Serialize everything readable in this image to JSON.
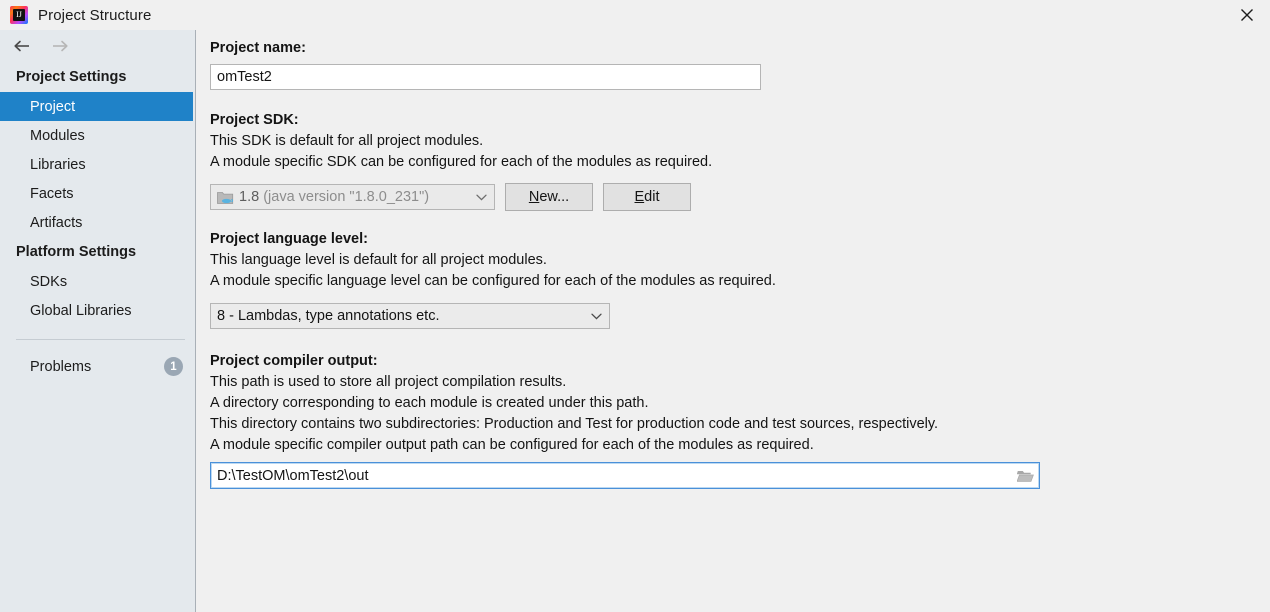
{
  "window": {
    "title": "Project Structure",
    "app_icon": "intellij-idea-logo",
    "close_icon": "close-icon"
  },
  "sidebar": {
    "nav": {
      "back_icon": "arrow-left-icon",
      "forward_icon": "arrow-right-icon"
    },
    "groups": [
      {
        "title": "Project Settings",
        "items": [
          {
            "label": "Project",
            "selected": true
          },
          {
            "label": "Modules",
            "selected": false
          },
          {
            "label": "Libraries",
            "selected": false
          },
          {
            "label": "Facets",
            "selected": false
          },
          {
            "label": "Artifacts",
            "selected": false
          }
        ]
      },
      {
        "title": "Platform Settings",
        "items": [
          {
            "label": "SDKs",
            "selected": false
          },
          {
            "label": "Global Libraries",
            "selected": false
          }
        ]
      }
    ],
    "problems": {
      "label": "Problems",
      "count": "1"
    }
  },
  "main": {
    "project_name": {
      "label": "Project name:",
      "value": "omTest2"
    },
    "project_sdk": {
      "label": "Project SDK:",
      "desc1": "This SDK is default for all project modules.",
      "desc2": "A module specific SDK can be configured for each of the modules as required.",
      "sdk_icon": "java-sdk-icon",
      "selected_version": "1.8",
      "selected_detail": "(java version \"1.8.0_231\")",
      "chevron_icon": "chevron-down-icon",
      "new_button": "New...",
      "new_button_mnemonic": "N",
      "new_button_rest": "ew...",
      "edit_button": "Edit",
      "edit_button_mnemonic": "E",
      "edit_button_rest": "dit"
    },
    "language_level": {
      "label": "Project language level:",
      "desc1": "This language level is default for all project modules.",
      "desc2": "A module specific language level can be configured for each of the modules as required.",
      "selected": "8 - Lambdas, type annotations etc.",
      "chevron_icon": "chevron-down-icon"
    },
    "compiler_output": {
      "label": "Project compiler output:",
      "desc1": "This path is used to store all project compilation results.",
      "desc2": "A directory corresponding to each module is created under this path.",
      "desc3": "This directory contains two subdirectories: Production and Test for production code and test sources, respectively.",
      "desc4": "A module specific compiler output path can be configured for each of the modules as required.",
      "path_value": "D:\\TestOM\\omTest2\\out",
      "browse_icon": "folder-browse-icon"
    }
  },
  "colors": {
    "selection_blue": "#1f82c8",
    "sidebar_bg": "#e4e9ed",
    "content_bg": "#f0f0f0",
    "focus_border": "#4a90d9",
    "badge_gray": "#9aa7b4"
  }
}
